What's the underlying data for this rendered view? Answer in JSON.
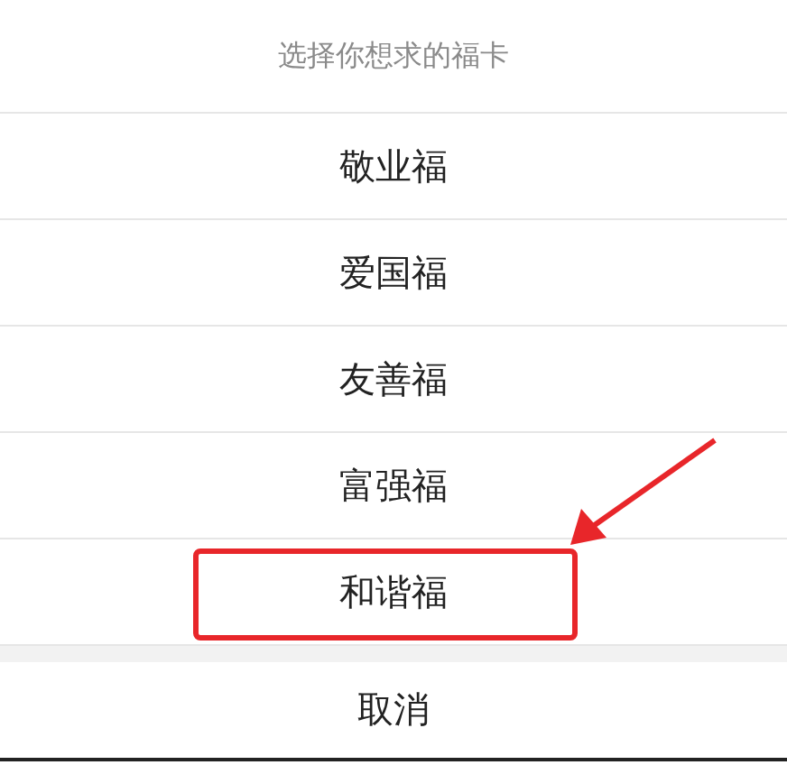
{
  "sheet": {
    "title": "选择你想求的福卡",
    "options": [
      {
        "label": "敬业福",
        "highlighted": false
      },
      {
        "label": "爱国福",
        "highlighted": false
      },
      {
        "label": "友善福",
        "highlighted": false
      },
      {
        "label": "富强福",
        "highlighted": false
      },
      {
        "label": "和谐福",
        "highlighted": true
      }
    ],
    "cancel": "取消"
  }
}
